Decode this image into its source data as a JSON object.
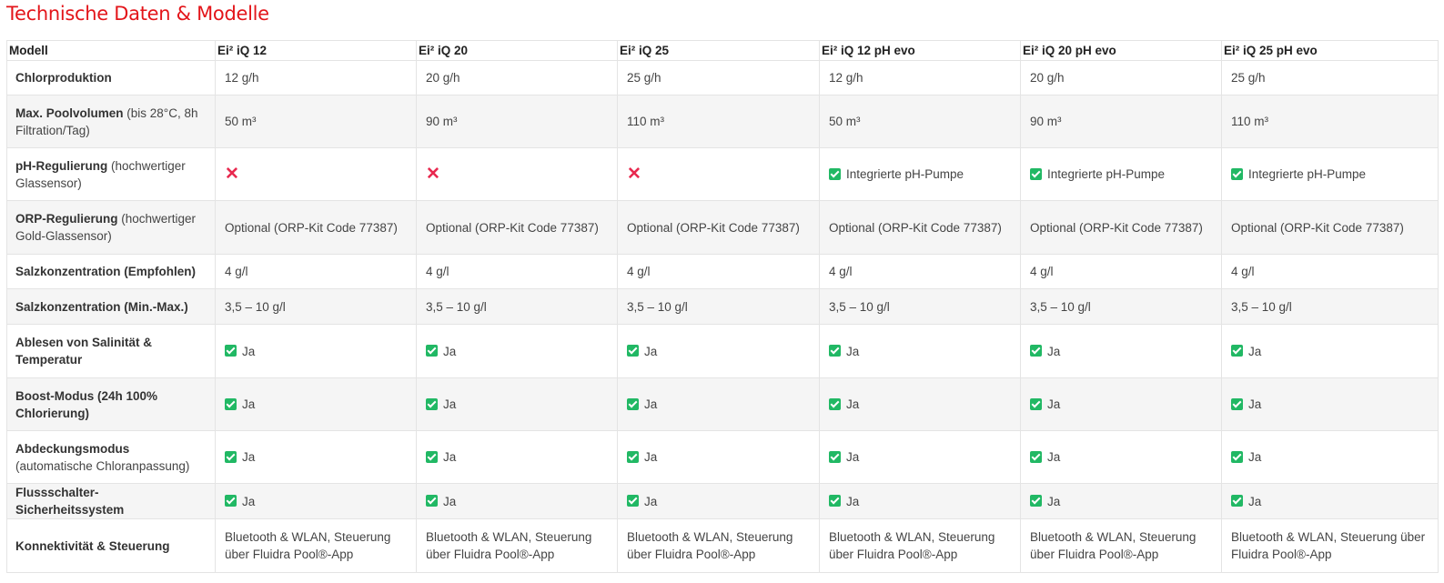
{
  "page": {
    "title": "Technische Daten & Modelle"
  },
  "table": {
    "header_label": "Modell",
    "models": [
      "Ei² iQ 12",
      "Ei² iQ 20",
      "Ei² iQ 25",
      "Ei² iQ 12 pH evo",
      "Ei² iQ 20 pH evo",
      "Ei² iQ 25 pH evo"
    ],
    "rows": [
      {
        "label": "Chlorproduktion",
        "note": "",
        "height": 38,
        "cells": [
          {
            "type": "text",
            "text": "12 g/h"
          },
          {
            "type": "text",
            "text": "20 g/h"
          },
          {
            "type": "text",
            "text": "25 g/h"
          },
          {
            "type": "text",
            "text": "12 g/h"
          },
          {
            "type": "text",
            "text": "20 g/h"
          },
          {
            "type": "text",
            "text": "25 g/h"
          }
        ]
      },
      {
        "label": "Max. Poolvolumen",
        "note": " (bis 28°C, 8h Filtration/Tag)",
        "height": 58,
        "cells": [
          {
            "type": "text",
            "text": "50 m³"
          },
          {
            "type": "text",
            "text": "90 m³"
          },
          {
            "type": "text",
            "text": "110 m³"
          },
          {
            "type": "text",
            "text": "50 m³"
          },
          {
            "type": "text",
            "text": "90 m³"
          },
          {
            "type": "text",
            "text": "110 m³"
          }
        ]
      },
      {
        "label": "pH-Regulierung",
        "note": " (hochwertiger Glassensor)",
        "height": 58,
        "cells": [
          {
            "type": "cross",
            "text": ""
          },
          {
            "type": "cross",
            "text": ""
          },
          {
            "type": "cross",
            "text": ""
          },
          {
            "type": "check",
            "text": "Integrierte pH-Pumpe"
          },
          {
            "type": "check",
            "text": "Integrierte pH-Pumpe"
          },
          {
            "type": "check",
            "text": "Integrierte pH-Pumpe"
          }
        ]
      },
      {
        "label": "ORP-Regulierung",
        "note": " (hochwertiger Gold-Glassensor)",
        "height": 59,
        "cells": [
          {
            "type": "text",
            "text": "Optional (ORP-Kit Code 77387)"
          },
          {
            "type": "text",
            "text": "Optional (ORP-Kit Code 77387)"
          },
          {
            "type": "text",
            "text": "Optional (ORP-Kit Code 77387)"
          },
          {
            "type": "text",
            "text": "Optional (ORP-Kit Code 77387)"
          },
          {
            "type": "text",
            "text": "Optional (ORP-Kit Code 77387)"
          },
          {
            "type": "text",
            "text": "Optional (ORP-Kit Code 77387)"
          }
        ]
      },
      {
        "label": "Salzkonzentration (Empfohlen)",
        "note": "",
        "height": 38,
        "cells": [
          {
            "type": "text",
            "text": "4 g/l"
          },
          {
            "type": "text",
            "text": "4 g/l"
          },
          {
            "type": "text",
            "text": "4 g/l"
          },
          {
            "type": "text",
            "text": "4 g/l"
          },
          {
            "type": "text",
            "text": "4 g/l"
          },
          {
            "type": "text",
            "text": "4 g/l"
          }
        ]
      },
      {
        "label": "Salzkonzentration (Min.-Max.)",
        "note": "",
        "height": 39,
        "cells": [
          {
            "type": "text",
            "text": "3,5 – 10 g/l"
          },
          {
            "type": "text",
            "text": "3,5 – 10 g/l"
          },
          {
            "type": "text",
            "text": "3,5 – 10 g/l"
          },
          {
            "type": "text",
            "text": "3,5 – 10 g/l"
          },
          {
            "type": "text",
            "text": "3,5 – 10 g/l"
          },
          {
            "type": "text",
            "text": "3,5 – 10 g/l"
          }
        ]
      },
      {
        "label": "Ablesen von Salinität & Temperatur",
        "note": "",
        "height": 59,
        "cells": [
          {
            "type": "check",
            "text": "Ja"
          },
          {
            "type": "check",
            "text": "Ja"
          },
          {
            "type": "check",
            "text": "Ja"
          },
          {
            "type": "check",
            "text": "Ja"
          },
          {
            "type": "check",
            "text": "Ja"
          },
          {
            "type": "check",
            "text": "Ja"
          }
        ]
      },
      {
        "label": "Boost-Modus (24h 100% Chlorierung)",
        "note": "",
        "height": 58,
        "cells": [
          {
            "type": "check",
            "text": "Ja"
          },
          {
            "type": "check",
            "text": "Ja"
          },
          {
            "type": "check",
            "text": "Ja"
          },
          {
            "type": "check",
            "text": "Ja"
          },
          {
            "type": "check",
            "text": "Ja"
          },
          {
            "type": "check",
            "text": "Ja"
          }
        ]
      },
      {
        "label": "Abdeckungsmodus",
        "note": " (automatische Chloranpassung)",
        "height": 58,
        "cells": [
          {
            "type": "check",
            "text": "Ja"
          },
          {
            "type": "check",
            "text": "Ja"
          },
          {
            "type": "check",
            "text": "Ja"
          },
          {
            "type": "check",
            "text": "Ja"
          },
          {
            "type": "check",
            "text": "Ja"
          },
          {
            "type": "check",
            "text": "Ja"
          }
        ]
      },
      {
        "label": "Flussschalter-Sicherheitssystem",
        "note": "",
        "height": 39,
        "cells": [
          {
            "type": "check",
            "text": "Ja"
          },
          {
            "type": "check",
            "text": "Ja"
          },
          {
            "type": "check",
            "text": "Ja"
          },
          {
            "type": "check",
            "text": "Ja"
          },
          {
            "type": "check",
            "text": "Ja"
          },
          {
            "type": "check",
            "text": "Ja"
          }
        ]
      },
      {
        "label": "Konnektivität & Steuerung",
        "note": "",
        "height": 59,
        "cells": [
          {
            "type": "text",
            "text": "Bluetooth & WLAN, Steuerung über Fluidra Pool®-App"
          },
          {
            "type": "text",
            "text": "Bluetooth & WLAN, Steuerung über Fluidra Pool®-App"
          },
          {
            "type": "text",
            "text": "Bluetooth & WLAN, Steuerung über Fluidra Pool®-App"
          },
          {
            "type": "text",
            "text": "Bluetooth & WLAN, Steuerung über Fluidra Pool®-App"
          },
          {
            "type": "text",
            "text": "Bluetooth & WLAN, Steuerung über Fluidra Pool®-App"
          },
          {
            "type": "text",
            "text": "Bluetooth & WLAN, Steuerung über Fluidra Pool®-App"
          }
        ]
      }
    ]
  },
  "icons": {
    "available": "check-icon",
    "unavailable": "cross-icon"
  },
  "colors": {
    "title": "#e3151a",
    "check": "#21b864",
    "cross": "#e8294f",
    "row_alt": "#f5f5f5"
  }
}
